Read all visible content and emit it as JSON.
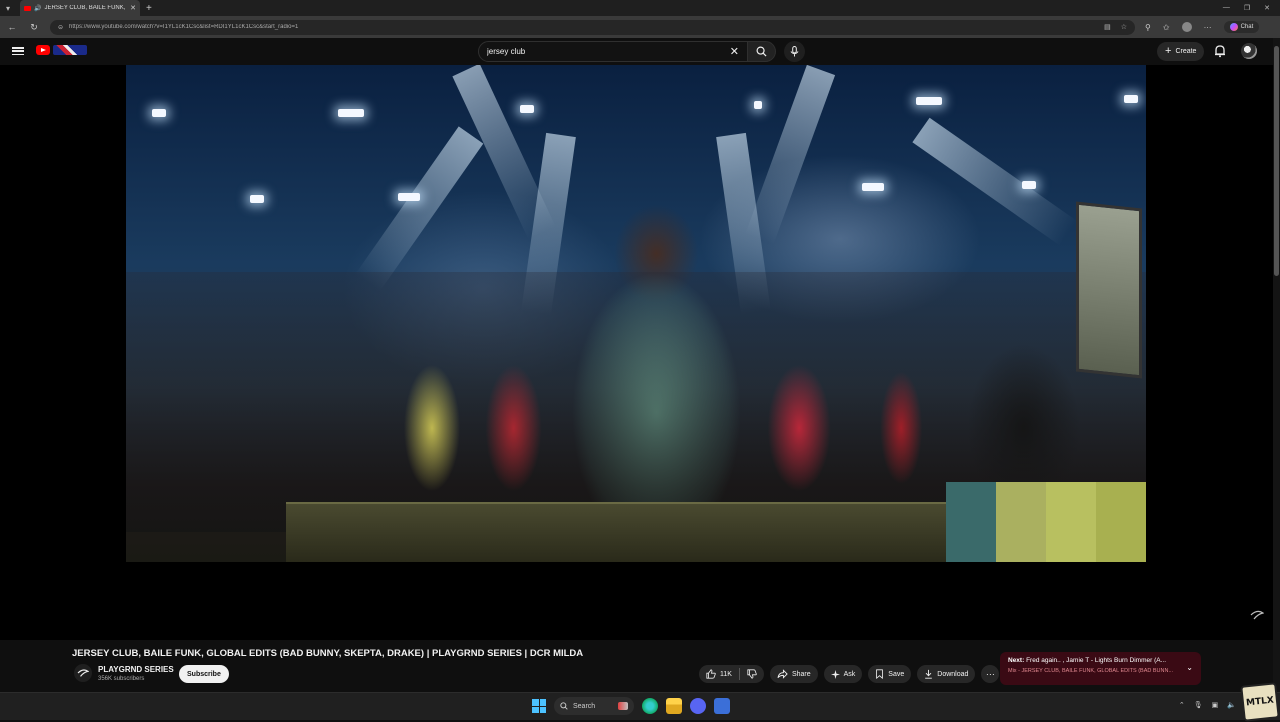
{
  "browser": {
    "tab_title": "JERSEY CLUB, BAILE FUNK, G",
    "url": "https://www.youtube.com/watch?v=I1YL1cK1Csc&list=RDI1YL1cK1Csc&start_radio=1",
    "chat_label": "Chat"
  },
  "masthead": {
    "search_value": "jersey club",
    "create_label": "Create"
  },
  "video": {
    "title": "JERSEY CLUB, BAILE FUNK, GLOBAL EDITS (BAD BUNNY, SKEPTA, DRAKE) | PLAYGRND SERIES | DCR MILDA",
    "channel_name": "PLAYGRND SERIES",
    "subscribers": "356K subscribers",
    "subscribe_label": "Subscribe",
    "like_count": "11K",
    "share_label": "Share",
    "ask_label": "Ask",
    "save_label": "Save",
    "download_label": "Download"
  },
  "up_next": {
    "prefix": "Next:",
    "title": "Fred again.. , Jamie T - Lights Burn Dimmer (A...",
    "playlist": "Mix - JERSEY CLUB, BAILE FUNK, GLOBAL EDITS (BAD BUNN..."
  },
  "taskbar": {
    "search_label": "Search"
  },
  "corner_logo_text": "MTLX",
  "colors": {
    "yt_red": "#ff0000",
    "background": "#0f0f0f",
    "pill": "#272727",
    "up_next_bg": "#3a0a14"
  }
}
